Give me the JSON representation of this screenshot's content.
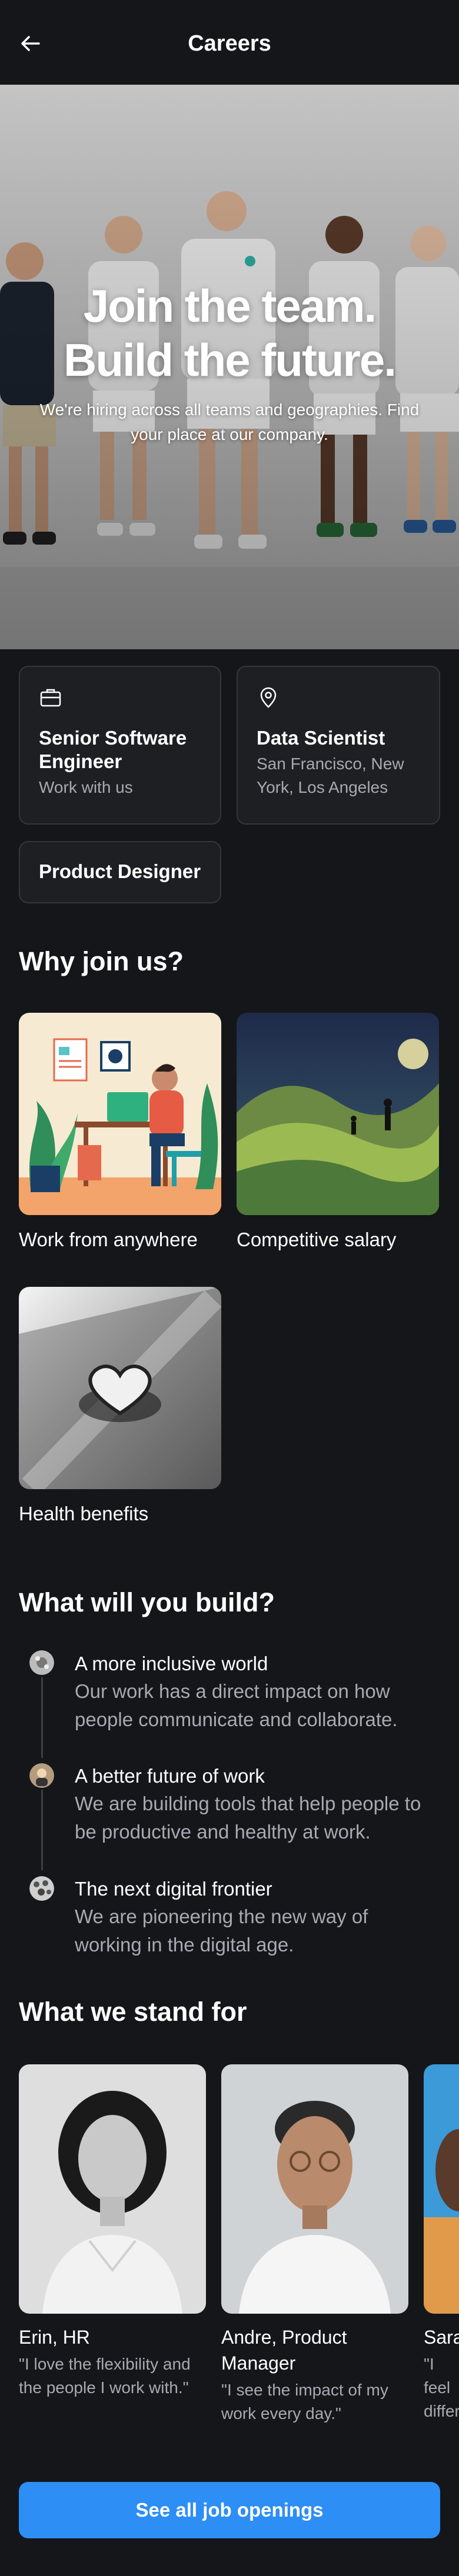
{
  "header": {
    "title": "Careers",
    "back_icon": "arrow-left-icon"
  },
  "hero": {
    "title": "Join the team. Build the future.",
    "subtitle": "We're hiring across all teams and geographies. Find your place at our company."
  },
  "jobs": [
    {
      "title": "Senior Software Engineer",
      "subtitle": "Work with us",
      "icon": "briefcase-icon"
    },
    {
      "title": "Data Scientist",
      "subtitle": "San Francisco, New York, Los Angeles",
      "icon": "map-pin-icon"
    },
    {
      "title": "Product Designer",
      "subtitle": ""
    }
  ],
  "why_join": {
    "title": "Why join us?",
    "items": [
      {
        "label": "Work from anywhere"
      },
      {
        "label": "Competitive salary"
      },
      {
        "label": "Health benefits"
      }
    ]
  },
  "build": {
    "title": "What will you build?",
    "items": [
      {
        "title": "A more inclusive world",
        "body": "Our work has a direct impact on how people communicate and collaborate."
      },
      {
        "title": "A better future of work",
        "body": "We are building tools that help people to be productive and healthy at work."
      },
      {
        "title": "The next digital frontier",
        "body": "We are pioneering the new way of working in the digital age."
      }
    ]
  },
  "stand_for": {
    "title": "What we stand for",
    "people": [
      {
        "name": "Erin, HR",
        "quote": "\"I love the flexibility and the people I work with.\""
      },
      {
        "name": "Andre, Product Manager",
        "quote": "\"I see the impact of my work every day.\""
      },
      {
        "name": "Sara",
        "quote": "\"I feel differ"
      }
    ]
  },
  "cta": {
    "label": "See all job openings"
  },
  "colors": {
    "background": "#151619",
    "card": "#1e1f23",
    "accent": "#2d8ef5",
    "muted_text": "#a7aab2"
  }
}
